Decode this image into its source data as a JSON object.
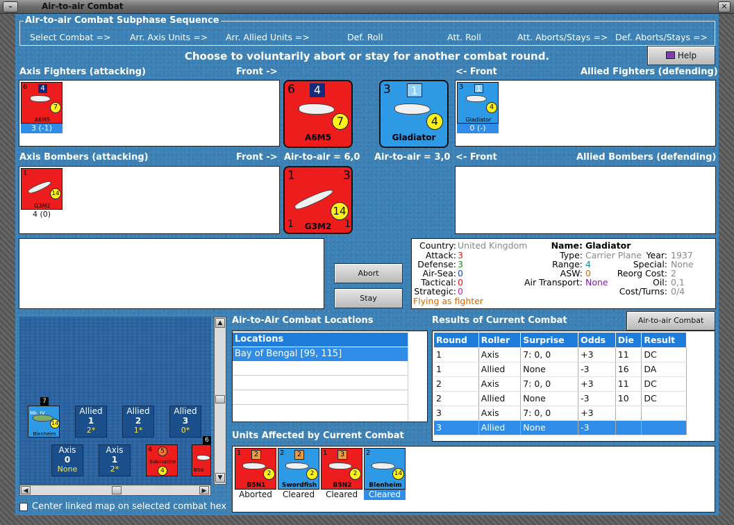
{
  "window": {
    "title": "Air-to-air Combat"
  },
  "sequence": {
    "label": "Air-to-air Combat Subphase Sequence",
    "steps": [
      "Select Combat =>",
      "Arr. Axis Units =>",
      "Arr. Allied Units =>",
      "Def. Roll",
      "Att. Roll",
      "Att. Aborts/Stays =>",
      "Def. Aborts/Stays =>"
    ]
  },
  "banner": "Choose to voluntarily abort or stay for another combat round.",
  "help_label": "Help",
  "axis_fighters": {
    "title": "Axis Fighters (attacking)",
    "front": "Front ->",
    "unit": {
      "name": "A6M5",
      "top_left": "6",
      "badge": "4",
      "range": "7",
      "stat": "3 (-1)"
    }
  },
  "allied_fighters": {
    "title": "Allied Fighters (defending)",
    "front": "<- Front",
    "unit": {
      "name": "Gladiator",
      "top_left": "3",
      "badge": "1",
      "range": "4",
      "stat": "0 (-)"
    }
  },
  "axis_bombers": {
    "title": "Axis Bombers (attacking)",
    "front": "Front ->",
    "unit": {
      "name": "G3M2",
      "top_left": "1",
      "top_right": "3",
      "range": "14",
      "stat": "4 (0)"
    }
  },
  "allied_bombers": {
    "title": "Allied Bombers (defending)",
    "front": "<- Front"
  },
  "combat": {
    "axis_big": {
      "name": "A6M5",
      "tl": "6",
      "badge": "4",
      "range": "7"
    },
    "allied_big": {
      "name": "Gladiator",
      "tl": "3",
      "badge": "1",
      "range": "4"
    },
    "axis_value": "Air-to-air = 6,0",
    "allied_value": "Air-to-air = 3,0",
    "bomber_big": {
      "name": "G3M2",
      "tl": "1",
      "tr": "3",
      "range": "14",
      "bl": "1",
      "br": "1"
    }
  },
  "buttons": {
    "abort": "Abort",
    "stay": "Stay",
    "chart": "Air-to-air Combat Chart"
  },
  "info": {
    "country_l": "Country:",
    "country_v": "United Kingdom",
    "attack_l": "Attack:",
    "attack_v": "3",
    "defense_l": "Defense:",
    "defense_v": "3",
    "airsea_l": "Air-Sea:",
    "airsea_v": "0",
    "tactical_l": "Tactical:",
    "tactical_v": "0",
    "strategic_l": "Strategic:",
    "strategic_v": "0",
    "flying": "Flying as fighter",
    "name_l": "Name:",
    "name_v": "Gladiator",
    "type_l": "Type:",
    "type_v": "Carrier Plane",
    "range_l": "Range:",
    "range_v": "4",
    "asw_l": "ASW:",
    "asw_v": "0",
    "airtrans_l": "Air Transport:",
    "airtrans_v": "None",
    "year_l": "Year:",
    "year_v": "1937",
    "special_l": "Special:",
    "special_v": "None",
    "reorg_l": "Reorg Cost:",
    "reorg_v": "2",
    "oil_l": "Oil:",
    "oil_v": "0,1",
    "cost_l": "Cost/Turns:",
    "cost_v": "0/4"
  },
  "locations": {
    "title": "Air-to-Air Combat Locations",
    "header": "Locations",
    "items": [
      "Bay of Bengal [99, 115]"
    ]
  },
  "results": {
    "title": "Results of Current Combat",
    "headers": [
      "Round",
      "Roller",
      "Surprise",
      "Odds",
      "Die",
      "Result"
    ],
    "rows": [
      [
        "1",
        "Axis",
        "7: 0, 0",
        "+3",
        "11",
        "DC"
      ],
      [
        "1",
        "Allied",
        "None",
        "-3",
        "16",
        "DA"
      ],
      [
        "2",
        "Axis",
        "7: 0, 0",
        "+3",
        "11",
        "DC"
      ],
      [
        "2",
        "Allied",
        "None",
        "-3",
        "10",
        "DC"
      ],
      [
        "3",
        "Axis",
        "7: 0, 0",
        "+3",
        "",
        ""
      ],
      [
        "3",
        "Allied",
        "None",
        "-3",
        "",
        ""
      ]
    ]
  },
  "affected": {
    "title": "Units Affected by Current Combat",
    "units": [
      {
        "name": "B5N1",
        "tl": "1",
        "badge": "2",
        "range": "2",
        "status": "Aborted",
        "color": "#ee1d1d"
      },
      {
        "name": "Swordfish",
        "tl": "2",
        "badge": "2",
        "range": "2",
        "status": "Cleared",
        "color": "#2e9ae6"
      },
      {
        "name": "B5N2",
        "tl": "1",
        "badge": "3",
        "range": "2",
        "status": "Cleared",
        "color": "#ee1d1d"
      },
      {
        "name": "Blenheim",
        "tl": "2",
        "badge": "",
        "range": "14",
        "status": "Cleared",
        "color": "#2e9ae6"
      }
    ]
  },
  "map": {
    "hexes": [
      {
        "side": "Allied",
        "n": "1",
        "v": "2*"
      },
      {
        "side": "Allied",
        "n": "2",
        "v": "1*"
      },
      {
        "side": "Allied",
        "n": "3",
        "v": "0*"
      },
      {
        "side": "Axis",
        "n": "0",
        "v": "None"
      },
      {
        "side": "Axis",
        "n": "1",
        "v": "2*"
      }
    ],
    "blenheim": {
      "name": "Blenheim",
      "tag": "7",
      "range": "14",
      "mk": "Mk. IV"
    },
    "sub": {
      "name": "Submarine",
      "tl": "4",
      "badge": "5",
      "range": "4"
    },
    "b5n": {
      "name": "B5N",
      "tag": "6"
    },
    "center_label": "Center linked map on selected combat hex"
  }
}
